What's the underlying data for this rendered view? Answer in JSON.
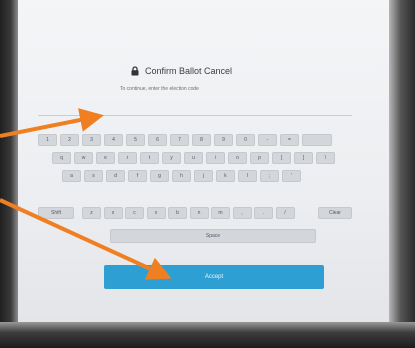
{
  "dialog": {
    "title": "Confirm Ballot Cancel",
    "subtitle": "To continue, enter the election code",
    "input_value": "",
    "accept_label": "Accept"
  },
  "keyboard": {
    "row1": [
      "1",
      "2",
      "3",
      "4",
      "5",
      "6",
      "7",
      "8",
      "9",
      "0",
      "-",
      "=",
      ""
    ],
    "row2": [
      "q",
      "w",
      "e",
      "r",
      "t",
      "y",
      "u",
      "i",
      "o",
      "p",
      "[",
      "]",
      "\\"
    ],
    "row3": [
      "a",
      "s",
      "d",
      "f",
      "g",
      "h",
      "j",
      "k",
      "l",
      ";",
      "'"
    ],
    "row4": [
      "Shift",
      "z",
      "x",
      "c",
      "v",
      "b",
      "n",
      "m",
      ",",
      ".",
      "/",
      "Clear"
    ],
    "space_label": "Space"
  },
  "colors": {
    "accent": "#2e9fd3",
    "annotation_arrow": "#f07f22"
  },
  "icons": {
    "title_icon": "lock-icon"
  }
}
